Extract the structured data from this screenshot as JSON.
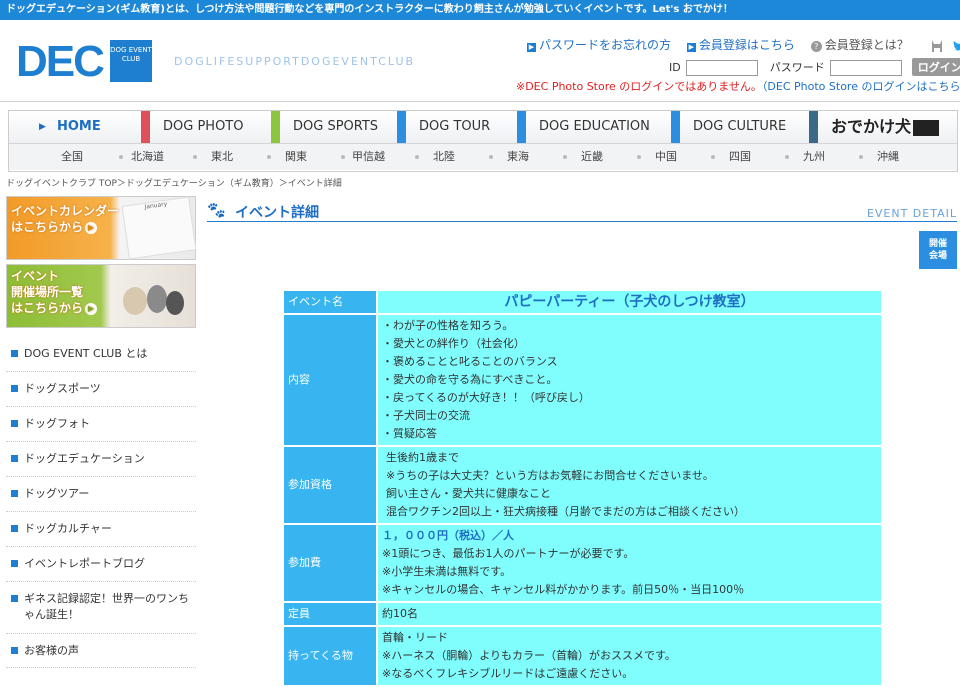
{
  "topbar": "ドッグエデュケーション(ギム教育)とは、しつけ方法や問題行動などを専門のインストラクターに教わり飼主さんが勉強していくイベントです。Let's おでかけ！",
  "logo": {
    "big": "DEC",
    "small": "DOG EVENT CLUB"
  },
  "tagline": "DOGLIFESUPPORTDOGEVENTCLUB",
  "header_links": {
    "forgot": "パスワードをお忘れの方",
    "register": "会員登録はこちら",
    "what": "会員登録とは？"
  },
  "login": {
    "id_label": "ID",
    "pw_label": "パスワード",
    "button": "ログイン"
  },
  "notice": {
    "red": "※DEC Photo Store のログインではありません。",
    "blue": "（DEC Photo Store のログインはこちら）"
  },
  "nav": {
    "home": "HOME",
    "items": [
      "DOG PHOTO",
      "DOG SPORTS",
      "DOG TOUR",
      "DOG EDUCATION",
      "DOG CULTURE"
    ],
    "colors": [
      "#e0505a",
      "#8cc63f",
      "#2b8ee0",
      "#2b8ee0",
      "#2b8ee0",
      "#3a6a88"
    ],
    "odekake": "おでかけ犬",
    "regions": [
      "全国",
      "北海道",
      "東北",
      "関東",
      "甲信越",
      "北陸",
      "東海",
      "近畿",
      "中国",
      "四国",
      "九州",
      "沖縄"
    ]
  },
  "breadcrumb": "ドッグイベントクラブ TOP＞ドッグエデュケーション（ギム教育）＞イベント詳細",
  "banners": {
    "calendar": [
      "イベントカレンダー",
      "はこちらから"
    ],
    "venues": [
      "イベント",
      "開催場所一覧",
      "はこちらから"
    ]
  },
  "sidebar": [
    "DOG EVENT CLUB とは",
    "ドッグスポーツ",
    "ドッグフォト",
    "ドッグエデュケーション",
    "ドッグツアー",
    "ドッグカルチャー",
    "イベントレポートブログ",
    "ギネス記録認定！世界一のワンちゃん誕生！",
    "お客様の声"
  ],
  "page_title": {
    "ja": "イベント詳細",
    "en": "EVENT DETAIL"
  },
  "venue_button": [
    "開催",
    "会場"
  ],
  "event": {
    "name_label": "イベント名",
    "name": "パピーパーティー（子犬のしつけ教室）",
    "content_label": "内容",
    "content": [
      "・わが子の性格を知ろう。",
      "・愛犬との絆作り（社会化）",
      "・褒めることと叱ることのバランス",
      "・愛犬の命を守る為にすべきこと。",
      "・戻ってくるのが大好き！！（呼び戻し）",
      "・子犬同士の交流",
      "・質疑応答"
    ],
    "qual_label": "参加資格",
    "qual": [
      "生後約1歳まで",
      "※うちの子は大丈夫？という方はお気軽にお問合せくださいませ。",
      "飼い主さん・愛犬共に健康なこと",
      "混合ワクチン2回以上・狂犬病接種（月齢でまだの方はご相談ください）"
    ],
    "fee_label": "参加費",
    "fee": [
      "１，０００円（税込）／人",
      "※1頭につき、最低お1人のパートナーが必要です。",
      "※小学生未満は無料です。",
      "※キャンセルの場合、キャンセル料がかかります。前日50％・当日100％"
    ],
    "cap_label": "定員",
    "cap": "約10名",
    "bring_label": "持ってくる物",
    "bring": [
      "首輪・リード",
      "※ハーネス（胴輪）よりもカラー（首輪）がおススメです。",
      "※なるべくフレキシブルリードはご遠慮ください。"
    ]
  }
}
